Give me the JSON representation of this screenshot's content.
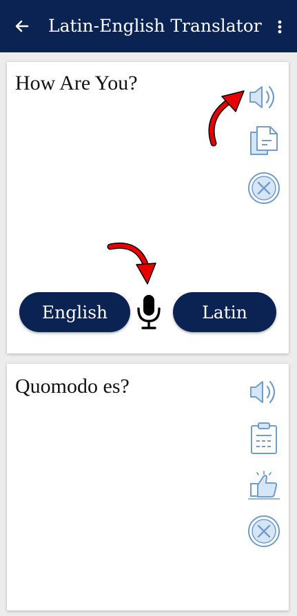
{
  "appbar": {
    "title": "Latin-English Translator",
    "back_icon": "arrow-left-icon",
    "menu_icon": "more-vertical-icon",
    "background": "#0b2352"
  },
  "source_card": {
    "text": "How Are You?",
    "icons": [
      "speaker-icon",
      "copy-icon",
      "clear-icon"
    ]
  },
  "language_bar": {
    "from_label": "English",
    "to_label": "Latin",
    "mic_icon": "microphone-icon"
  },
  "target_card": {
    "text": "Quomodo es?",
    "icons": [
      "speaker-icon",
      "clipboard-icon",
      "thumbs-up-icon",
      "clear-icon"
    ]
  },
  "colors": {
    "brand": "#0b2352",
    "icon_outline": "#6f9cc8",
    "icon_fill": "#d6e6f6",
    "annotation_arrow": "#e60000"
  }
}
